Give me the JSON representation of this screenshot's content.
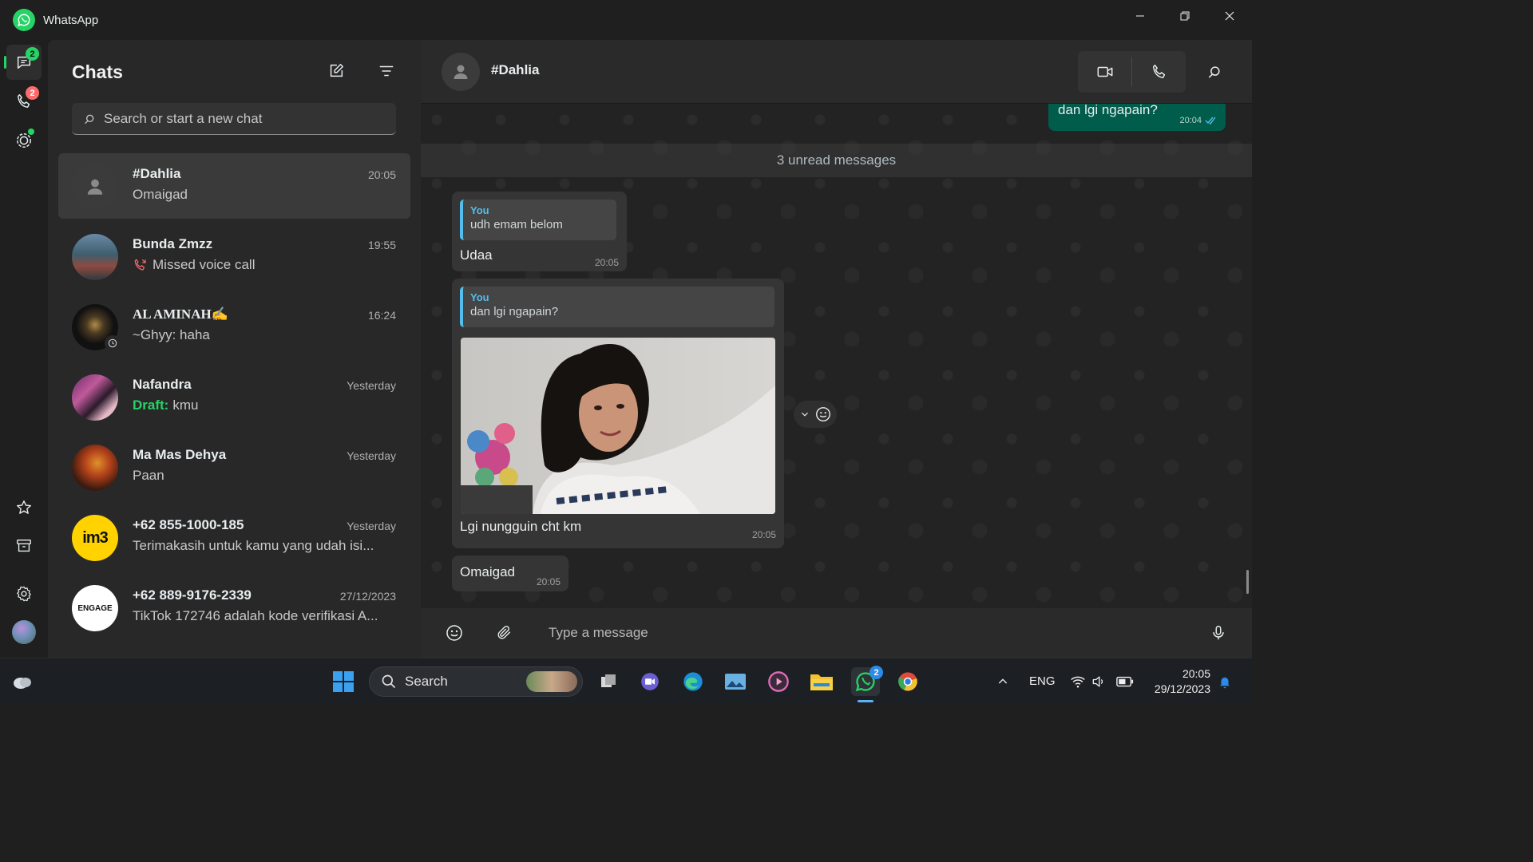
{
  "window": {
    "title": "WhatsApp",
    "controls": [
      "minimize",
      "restore",
      "close"
    ]
  },
  "rail": {
    "items": [
      {
        "name": "chats",
        "badge": "2"
      },
      {
        "name": "calls",
        "badge": "2"
      },
      {
        "name": "status",
        "badge": ""
      },
      {
        "name": "starred",
        "badge": ""
      },
      {
        "name": "archived",
        "badge": ""
      },
      {
        "name": "settings",
        "badge": ""
      },
      {
        "name": "profile",
        "badge": ""
      }
    ]
  },
  "chatlist": {
    "title": "Chats",
    "search_placeholder": "Search or start a new chat",
    "chats": [
      {
        "name": "#Dahlia",
        "time": "20:05",
        "preview": "Omaigad",
        "selected": true
      },
      {
        "name": "Bunda Zmzz",
        "time": "19:55",
        "preview": "Missed voice call",
        "missed_call": true
      },
      {
        "name": "AL AMINAH✍",
        "time": "16:24",
        "preview": "~Ghyy: haha"
      },
      {
        "name": "Nafandra",
        "time": "Yesterday",
        "draft_label": "Draft:",
        "preview": "kmu"
      },
      {
        "name": "Ma Mas Dehya",
        "time": "Yesterday",
        "preview": "Paan"
      },
      {
        "name": "+62 855-1000-185",
        "time": "Yesterday",
        "preview": "Terimakasih untuk kamu yang udah isi..."
      },
      {
        "name": "+62 889-9176-2339",
        "time": "27/12/2023",
        "preview": "TikTok 172746 adalah kode verifikasi A..."
      }
    ],
    "avatar_labels": {
      "im3": "im3",
      "engage": "ENGAGE"
    }
  },
  "conversation": {
    "contact_name": "#Dahlia",
    "unread_label": "3 unread messages",
    "outgoing": {
      "text": "dan lgi ngapain?",
      "time": "20:04"
    },
    "incoming": [
      {
        "quote_author": "You",
        "quote_text": "udh emam belom",
        "text": "Udaa",
        "time": "20:05"
      },
      {
        "quote_author": "You",
        "quote_text": "dan lgi ngapain?",
        "text": "Lgi nungguin cht km",
        "time": "20:05",
        "has_photo": true
      },
      {
        "text": "Omaigad",
        "time": "20:05"
      }
    ],
    "composer_placeholder": "Type a message"
  },
  "taskbar": {
    "search_label": "Search",
    "whatsapp_badge": "2",
    "language": "ENG",
    "time": "20:05",
    "date": "29/12/2023"
  },
  "colors": {
    "accent_green": "#25d366",
    "outgoing_bubble": "#005c4b",
    "quote_blue": "#53bdeb",
    "missed_red": "#ff6b6b"
  }
}
